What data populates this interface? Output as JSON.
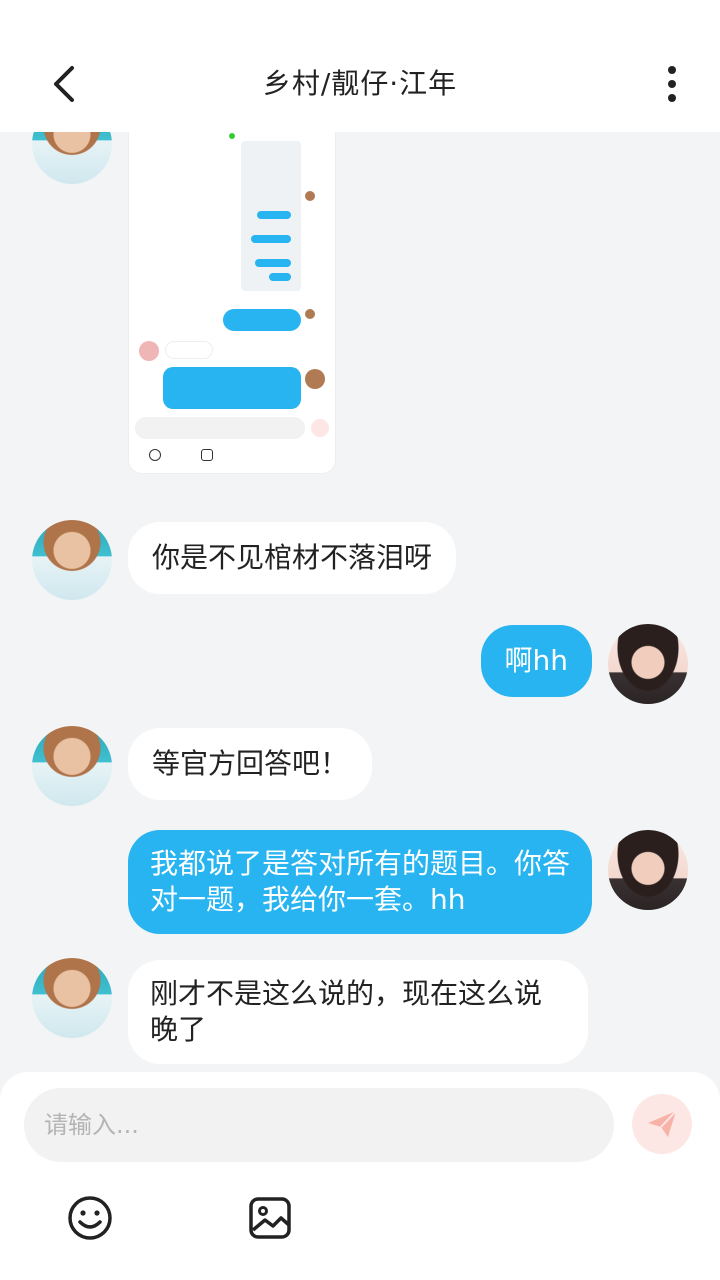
{
  "header": {
    "title": "乡村/靓仔·江年"
  },
  "icons": {
    "back": "chevron-left-icon",
    "more": "more-vertical-icon",
    "emoji": "smile-icon",
    "image": "image-icon",
    "send": "send-icon"
  },
  "colors": {
    "self_bubble": "#28b4f0",
    "other_bubble": "#ffffff",
    "background": "#f3f4f6",
    "send_button": "#fde7e4"
  },
  "messages": [
    {
      "sender": "other",
      "type": "image"
    },
    {
      "sender": "other",
      "text": "你是不见棺材不落泪呀"
    },
    {
      "sender": "self",
      "text": "啊hh"
    },
    {
      "sender": "other",
      "text": "等官方回答吧！"
    },
    {
      "sender": "self",
      "text": "我都说了是答对所有的题目。你答对一题，我给你一套。hh"
    },
    {
      "sender": "other",
      "text": "刚才不是这么说的，现在这么说晚了"
    }
  ],
  "input": {
    "placeholder": "请输入..."
  }
}
